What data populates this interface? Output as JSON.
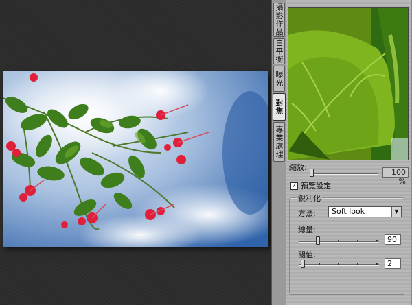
{
  "tabs": [
    {
      "label": "攝影作品",
      "active": false
    },
    {
      "label": "白平衡",
      "active": false
    },
    {
      "label": "曝光",
      "active": false
    },
    {
      "label": "對焦",
      "active": true
    },
    {
      "label": "專業處理",
      "active": false
    }
  ],
  "zoom": {
    "label": "縮放:",
    "value": "100 %"
  },
  "preview_setting": {
    "label": "預覽設定",
    "checked": true,
    "check_glyph": "✓"
  },
  "sharpen": {
    "group_title": "銳利化",
    "method": {
      "label": "方法:",
      "selected": "Soft look"
    },
    "amount": {
      "label": "總量:",
      "value": "90"
    },
    "threshold": {
      "label": "閾值:",
      "value": "2"
    }
  },
  "colors": {
    "panel_bg": "#b4b4b4",
    "canvas_bg": "#2b2b2b",
    "sky": "#3f74b8",
    "leaf": "#4a8a1f",
    "flower": "#e0203a"
  }
}
